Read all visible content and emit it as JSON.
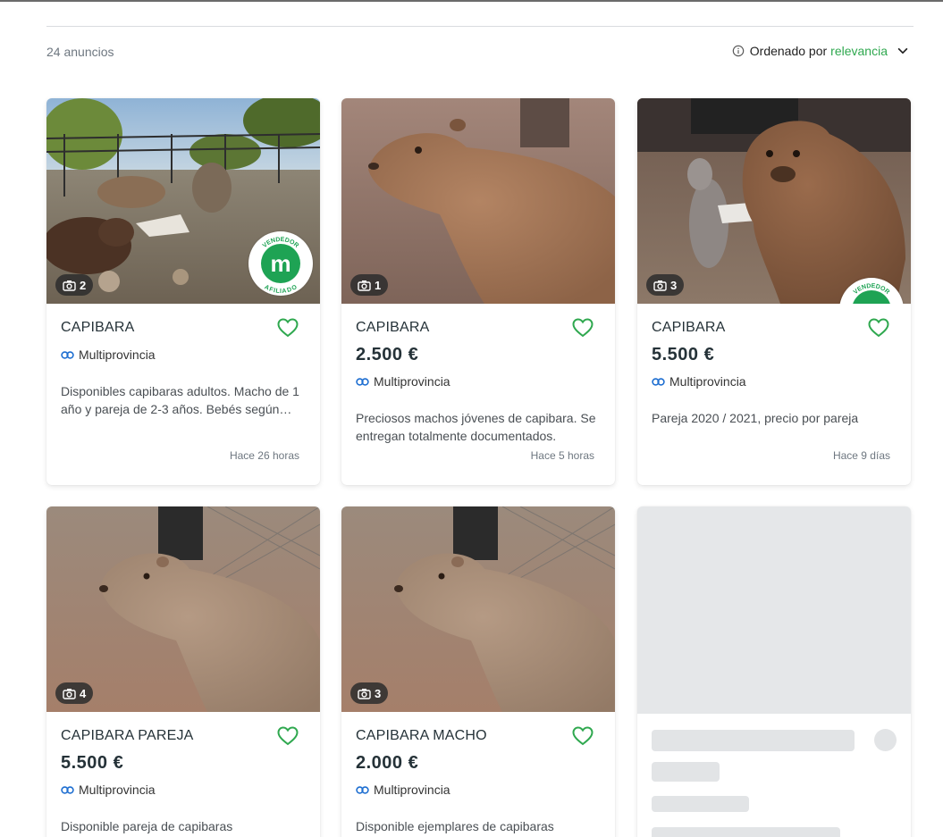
{
  "results": {
    "count_label": "24 anuncios",
    "sort_label": "Ordenado por",
    "sort_value": "relevancia"
  },
  "icons": {
    "info": "info-icon",
    "chevron": "chevron-down-icon",
    "camera": "camera-icon",
    "heart": "heart-outline-icon",
    "location": "location-link-icon"
  },
  "colors": {
    "accent_green": "#2fa84f",
    "badge_green": "#1ea354",
    "location_blue": "#1f6fd1"
  },
  "badges": {
    "seller_line1": "VENDEDOR",
    "seller_line2": "AFILIADO",
    "letter": "m"
  },
  "listings": [
    {
      "title": "CAPIBARA",
      "price": "",
      "location": "Multiprovincia",
      "description": "Disponibles capibaras adultos. Macho de 1 año y pareja de 2-3 años. Bebés según disponibilidad.",
      "time": "Hace 26 horas",
      "photos": "2",
      "affiliated": true
    },
    {
      "title": "CAPIBARA",
      "price": "2.500 €",
      "location": "Multiprovincia",
      "description": "Preciosos machos jóvenes de capibara. Se entregan totalmente documentados.",
      "time": "Hace 5 horas",
      "photos": "1",
      "affiliated": false
    },
    {
      "title": "CAPIBARA",
      "price": "5.500 €",
      "location": "Multiprovincia",
      "description": "Pareja 2020 / 2021, precio por pareja",
      "time": "Hace 9 días",
      "photos": "3",
      "affiliated": true
    },
    {
      "title": "CAPIBARA PAREJA",
      "price": "5.500 €",
      "location": "Multiprovincia",
      "description": "Disponible pareja de capibaras",
      "time": "",
      "photos": "4",
      "affiliated": false
    },
    {
      "title": "CAPIBARA MACHO",
      "price": "2.000 €",
      "location": "Multiprovincia",
      "description": "Disponible ejemplares de capibaras",
      "time": "",
      "photos": "3",
      "affiliated": false
    }
  ]
}
